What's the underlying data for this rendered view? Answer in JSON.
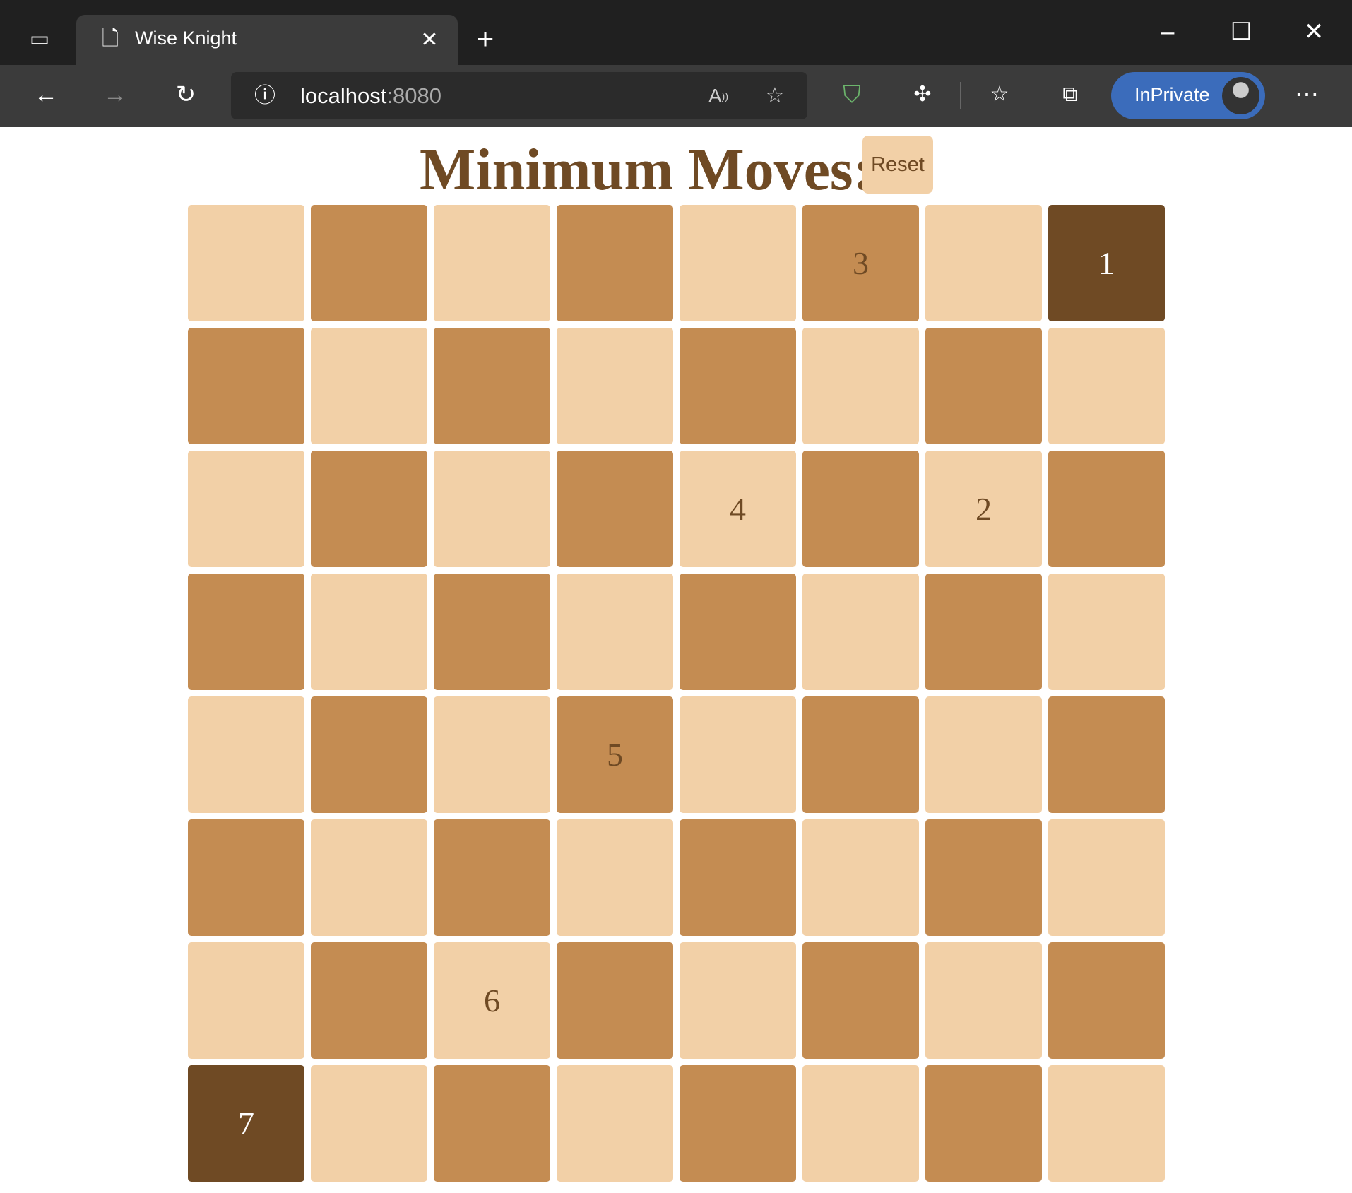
{
  "browser": {
    "tab_title": "Wise Knight",
    "url_host": "localhost",
    "url_port": ":8080",
    "inprivate_label": "InPrivate"
  },
  "game": {
    "title": "Minimum Moves: 6",
    "reset_label": "Reset",
    "colors": {
      "light": "#f2d0a7",
      "dark": "#c48c52",
      "highlight": "#6f4a24",
      "text": "#6f4a24"
    },
    "board": [
      [
        "",
        "",
        "",
        "",
        "",
        "3",
        "",
        "1"
      ],
      [
        "",
        "",
        "",
        "",
        "",
        "",
        "",
        ""
      ],
      [
        "",
        "",
        "",
        "",
        "4",
        "",
        "2",
        ""
      ],
      [
        "",
        "",
        "",
        "",
        "",
        "",
        "",
        ""
      ],
      [
        "",
        "",
        "",
        "5",
        "",
        "",
        "",
        ""
      ],
      [
        "",
        "",
        "",
        "",
        "",
        "",
        "",
        ""
      ],
      [
        "",
        "",
        "6",
        "",
        "",
        "",
        "",
        ""
      ],
      [
        "7",
        "",
        "",
        "",
        "",
        "",
        "",
        ""
      ]
    ],
    "highlighted": [
      [
        0,
        7
      ],
      [
        7,
        0
      ]
    ]
  }
}
